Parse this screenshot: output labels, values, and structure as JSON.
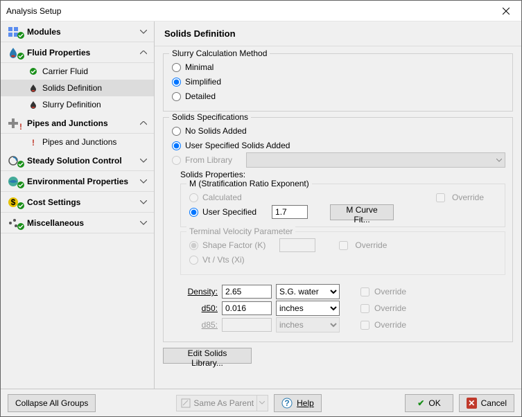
{
  "window": {
    "title": "Analysis Setup"
  },
  "sidebar": {
    "groups": [
      {
        "label": "Modules",
        "expanded": false,
        "status": "ok"
      },
      {
        "label": "Fluid Properties",
        "expanded": true,
        "status": "ok",
        "items": [
          {
            "label": "Carrier Fluid",
            "status": "ok"
          },
          {
            "label": "Solids Definition",
            "status": "neutral",
            "selected": true
          },
          {
            "label": "Slurry Definition",
            "status": "neutral"
          }
        ]
      },
      {
        "label": "Pipes and Junctions",
        "expanded": true,
        "status": "warn",
        "items": [
          {
            "label": "Pipes and Junctions",
            "status": "warn"
          }
        ]
      },
      {
        "label": "Steady Solution Control",
        "expanded": false,
        "status": "ok"
      },
      {
        "label": "Environmental Properties",
        "expanded": false,
        "status": "ok"
      },
      {
        "label": "Cost Settings",
        "expanded": false,
        "status": "ok"
      },
      {
        "label": "Miscellaneous",
        "expanded": false,
        "status": "ok"
      }
    ]
  },
  "main": {
    "title": "Solids Definition",
    "slurryCalc": {
      "title": "Slurry Calculation Method",
      "options": [
        "Minimal",
        "Simplified",
        "Detailed"
      ],
      "selected": "Simplified"
    },
    "solidsSpec": {
      "title": "Solids Specifications",
      "options": [
        "No Solids Added",
        "User Specified Solids Added",
        "From Library"
      ],
      "selected": "User Specified Solids Added",
      "propsTitle": "Solids Properties:",
      "mGroup": {
        "title": "M (Stratification Ratio Exponent)",
        "options": [
          "Calculated",
          "User Specified"
        ],
        "selected": "User Specified",
        "value": "1.7",
        "overrideLabel": "Override",
        "curveFitBtn": "M Curve Fit..."
      },
      "tvGroup": {
        "title": "Terminal Velocity Parameter",
        "options": [
          "Shape Factor (K)",
          "Vt / Vts (Xi)"
        ],
        "selected": "Shape Factor (K)",
        "value": "",
        "overrideLabel": "Override"
      },
      "density": {
        "label": "Density:",
        "value": "2.65",
        "unit": "S.G. water",
        "overrideLabel": "Override"
      },
      "d50": {
        "label": "d50:",
        "value": "0.016",
        "unit": "inches",
        "overrideLabel": "Override"
      },
      "d85": {
        "label": "d85:",
        "value": "",
        "unit": "inches",
        "overrideLabel": "Override"
      }
    },
    "editLibBtn": "Edit Solids Library..."
  },
  "footer": {
    "collapse": "Collapse All Groups",
    "sameAsParent": "Same As Parent",
    "help": "Help",
    "ok": "OK",
    "cancel": "Cancel"
  }
}
